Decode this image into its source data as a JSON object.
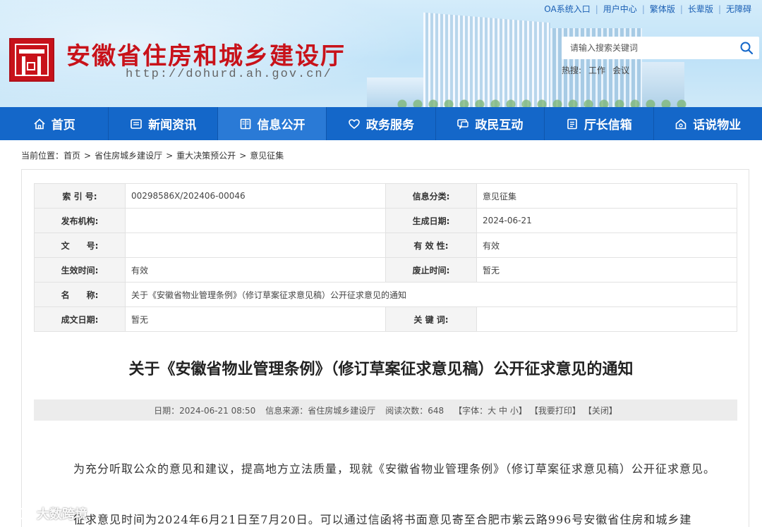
{
  "header": {
    "site_title": "安徽省住房和城乡建设厅",
    "site_url": "http://dohurd.ah.gov.cn/",
    "top_links": [
      "OA系统入口",
      "用户中心",
      "繁体版",
      "长辈版",
      "无障碍"
    ],
    "search": {
      "placeholder": "请输入搜索关键词"
    },
    "hot": {
      "label": "热搜:",
      "words": [
        "工作",
        "会议"
      ]
    }
  },
  "nav": {
    "items": [
      {
        "label": "首页",
        "icon": "home-icon"
      },
      {
        "label": "新闻资讯",
        "icon": "news-icon"
      },
      {
        "label": "信息公开",
        "icon": "document-icon"
      },
      {
        "label": "政务服务",
        "icon": "service-icon"
      },
      {
        "label": "政民互动",
        "icon": "chat-icon"
      },
      {
        "label": "厅长信箱",
        "icon": "mailbox-icon"
      },
      {
        "label": "话说物业",
        "icon": "house-icon"
      }
    ],
    "active_index": 2
  },
  "breadcrumb": {
    "prefix": "当前位置：",
    "items": [
      "首页",
      "省住房城乡建设厅",
      "重大决策预公开",
      "意见征集"
    ]
  },
  "meta": {
    "index_label": "索 引 号:",
    "index_value": "00298586X/202406-00046",
    "category_label": "信息分类:",
    "category_value": "意见征集",
    "publisher_label": "发布机构:",
    "publisher_value": "",
    "created_label": "生成日期:",
    "created_value": "2024-06-21",
    "docno_label": "文　　号:",
    "docno_value": "",
    "validity_label": "有 效 性:",
    "validity_value": "有效",
    "effective_label": "生效时间:",
    "effective_value": "有效",
    "expire_label": "废止时间:",
    "expire_value": "暂无",
    "name_label": "名　　称:",
    "name_value": "关于《安徽省物业管理条例》（修订草案征求意见稿）公开征求意见的通知",
    "formed_label": "成文日期:",
    "formed_value": "暂无",
    "keywords_label": "关 键 词:",
    "keywords_value": ""
  },
  "article": {
    "title": "关于《安徽省物业管理条例》（修订草案征求意见稿）公开征求意见的通知",
    "date": "日期：2024-06-21 08:50",
    "source": "信息来源：省住房城乡建设厅",
    "views": "阅读次数：648",
    "font_size_label": "【字体：",
    "font_big": "大",
    "font_mid": "中",
    "font_small": "小",
    "font_close": "】",
    "print": "【我要打印】",
    "close": "【关闭】",
    "para1": "为充分听取公众的意见和建议，提高地方立法质量，现就《安徽省物业管理条例》（修订草案征求意见稿）公开征求意见。",
    "para2": "征求意见时间为2024年6月21日至7月20日。可以通过信函将书面意见寄至合肥市紫云路996号安徽省住房和城乡建"
  },
  "watermark": "大数跨境"
}
